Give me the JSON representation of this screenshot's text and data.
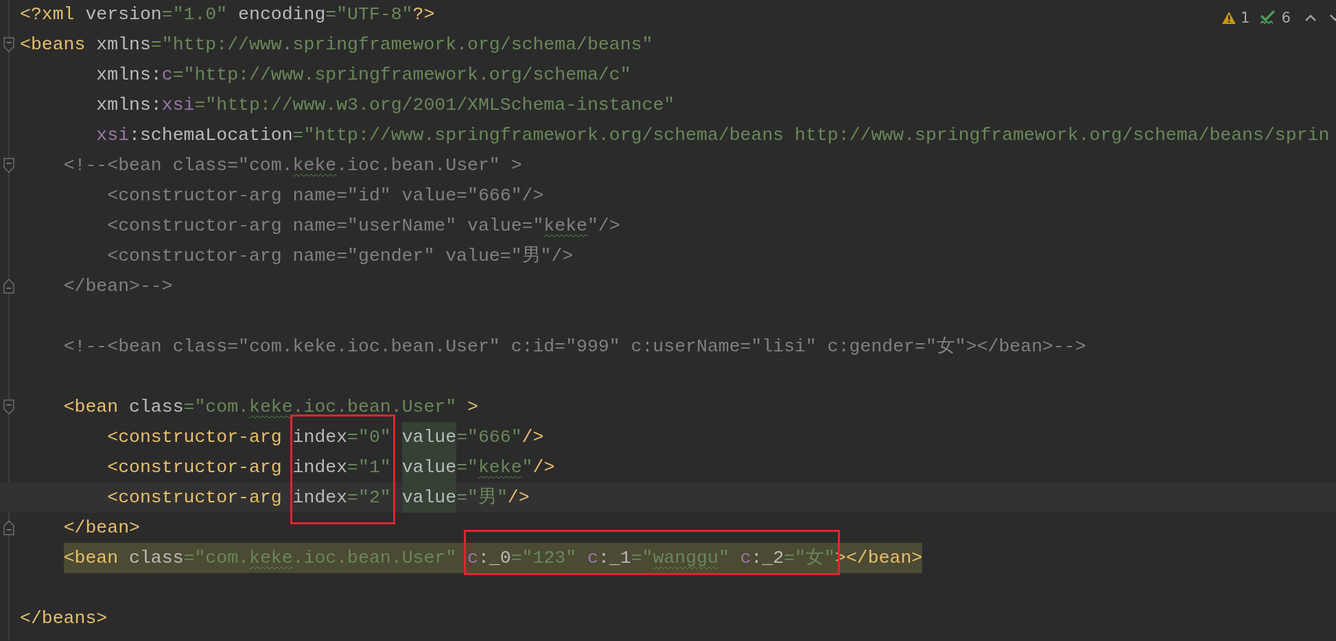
{
  "inspections": {
    "warnings": "1",
    "weak_warnings": "6"
  },
  "lines": [
    {
      "kind": "plain",
      "current": false,
      "highlighted": false,
      "tokens": [
        {
          "t": "<?xml",
          "kind": "tag"
        },
        {
          "t": " version",
          "kind": "attr"
        },
        {
          "t": "=\"1.0\"",
          "kind": "val"
        },
        {
          "t": " encoding",
          "kind": "attr"
        },
        {
          "t": "=\"UTF-8\"",
          "kind": "val"
        },
        {
          "t": "?>",
          "kind": "tag"
        }
      ]
    },
    {
      "kind": "open",
      "current": false,
      "highlighted": false,
      "tokens": [
        {
          "t": "<beans",
          "kind": "tag"
        },
        {
          "t": " xmlns",
          "kind": "attr"
        },
        {
          "t": "=\"http://www.springframework.org/schema/beans\"",
          "kind": "val"
        }
      ]
    },
    {
      "kind": "plain",
      "current": false,
      "highlighted": false,
      "tokens": [
        {
          "t": "       xmlns:",
          "kind": "attr"
        },
        {
          "t": "c",
          "kind": "ns"
        },
        {
          "t": "=\"http://www.springframework.org/schema/c\"",
          "kind": "val"
        }
      ]
    },
    {
      "kind": "plain",
      "current": false,
      "highlighted": false,
      "tokens": [
        {
          "t": "       xmlns:",
          "kind": "attr"
        },
        {
          "t": "xsi",
          "kind": "ns"
        },
        {
          "t": "=\"http://www.w3.org/2001/XMLSchema-instance\"",
          "kind": "val"
        }
      ]
    },
    {
      "kind": "plain",
      "current": false,
      "highlighted": false,
      "tokens": [
        {
          "t": "       xsi",
          "kind": "ns"
        },
        {
          "t": ":schemaLocation",
          "kind": "attr"
        },
        {
          "t": "=\"http://www.springframework.org/schema/beans http://www.springframework.org/schema/beans/sprin",
          "kind": "val"
        }
      ]
    },
    {
      "kind": "open",
      "current": false,
      "highlighted": false,
      "tokens": [
        {
          "t": "    <!--<bean class=\"com.",
          "kind": "cmt"
        },
        {
          "t": "keke",
          "kind": "cmt",
          "typo": true
        },
        {
          "t": ".ioc.bean.User\" >",
          "kind": "cmt"
        }
      ]
    },
    {
      "kind": "plain",
      "current": false,
      "highlighted": false,
      "tokens": [
        {
          "t": "        <constructor-arg name=\"id\" value=\"666\"/>",
          "kind": "cmt"
        }
      ]
    },
    {
      "kind": "plain",
      "current": false,
      "highlighted": false,
      "tokens": [
        {
          "t": "        <constructor-arg name=\"userName\" value=\"",
          "kind": "cmt"
        },
        {
          "t": "keke",
          "kind": "cmt",
          "typo": true
        },
        {
          "t": "\"/>",
          "kind": "cmt"
        }
      ]
    },
    {
      "kind": "plain",
      "current": false,
      "highlighted": false,
      "tokens": [
        {
          "t": "        <constructor-arg name=\"gender\" value=\"男\"/>",
          "kind": "cmt"
        }
      ]
    },
    {
      "kind": "close",
      "current": false,
      "highlighted": false,
      "tokens": [
        {
          "t": "    </bean>-->",
          "kind": "cmt"
        }
      ]
    },
    {
      "kind": "blank"
    },
    {
      "kind": "plain",
      "current": false,
      "highlighted": false,
      "tokens": [
        {
          "t": "    <!--<bean class=\"com.keke.ioc.bean.User\" c:id=\"999\" c:userName=\"lisi\" c:gender=\"女\"></bean>-->",
          "kind": "cmt"
        }
      ]
    },
    {
      "kind": "blank"
    },
    {
      "kind": "open",
      "current": false,
      "highlighted": false,
      "tokens": [
        {
          "t": "    <bean",
          "kind": "tag"
        },
        {
          "t": " class",
          "kind": "attr"
        },
        {
          "t": "=\"com.",
          "kind": "val"
        },
        {
          "t": "keke",
          "kind": "val",
          "typo": true
        },
        {
          "t": ".ioc.bean.User\"",
          "kind": "val"
        },
        {
          "t": " >",
          "kind": "tag"
        }
      ]
    },
    {
      "kind": "plain",
      "current": false,
      "highlighted": false,
      "tokens": [
        {
          "t": "        <constructor-arg",
          "kind": "tag"
        },
        {
          "t": " index",
          "kind": "attr"
        },
        {
          "t": "=\"0\" ",
          "kind": "val"
        },
        {
          "t": "value",
          "kind": "attr",
          "match": true
        },
        {
          "t": "=\"666\"",
          "kind": "val"
        },
        {
          "t": "/>",
          "kind": "tag"
        }
      ]
    },
    {
      "kind": "plain",
      "current": false,
      "highlighted": false,
      "tokens": [
        {
          "t": "        <constructor-arg",
          "kind": "tag"
        },
        {
          "t": " index",
          "kind": "attr"
        },
        {
          "t": "=\"1\" ",
          "kind": "val"
        },
        {
          "t": "value",
          "kind": "attr",
          "match": true
        },
        {
          "t": "=\"",
          "kind": "val"
        },
        {
          "t": "keke",
          "kind": "val",
          "typo": true
        },
        {
          "t": "\"",
          "kind": "val"
        },
        {
          "t": "/>",
          "kind": "tag"
        }
      ]
    },
    {
      "kind": "plain",
      "current": true,
      "highlighted": false,
      "tokens": [
        {
          "t": "        <constructor-arg",
          "kind": "tag"
        },
        {
          "t": " index",
          "kind": "attr"
        },
        {
          "t": "=\"2\" ",
          "kind": "val"
        },
        {
          "t": "value",
          "kind": "attr",
          "match": true
        },
        {
          "t": "=\"男\"",
          "kind": "val"
        },
        {
          "t": "/>",
          "kind": "tag"
        }
      ]
    },
    {
      "kind": "close",
      "current": false,
      "highlighted": false,
      "tokens": [
        {
          "t": "    </bean>",
          "kind": "tag"
        }
      ]
    },
    {
      "kind": "plain",
      "current": false,
      "highlighted": true,
      "tokens": [
        {
          "t": "    <bean",
          "kind": "tag"
        },
        {
          "t": " class",
          "kind": "attr"
        },
        {
          "t": "=\"com.",
          "kind": "val"
        },
        {
          "t": "keke",
          "kind": "val",
          "typo": true
        },
        {
          "t": ".ioc.bean.User\" ",
          "kind": "val"
        },
        {
          "t": "c",
          "kind": "ns"
        },
        {
          "t": ":_0",
          "kind": "attr"
        },
        {
          "t": "=\"123\" ",
          "kind": "val"
        },
        {
          "t": "c",
          "kind": "ns"
        },
        {
          "t": ":_1",
          "kind": "attr"
        },
        {
          "t": "=\"",
          "kind": "val"
        },
        {
          "t": "wanggu",
          "kind": "val",
          "typo": true
        },
        {
          "t": "\" ",
          "kind": "val"
        },
        {
          "t": "c",
          "kind": "ns"
        },
        {
          "t": ":_2",
          "kind": "attr"
        },
        {
          "t": "=\"女\"",
          "kind": "val"
        },
        {
          "t": "></bean>",
          "kind": "tag"
        }
      ]
    },
    {
      "kind": "blank"
    },
    {
      "kind": "plain",
      "current": false,
      "highlighted": false,
      "tokens": [
        {
          "t": "</beans>",
          "kind": "tag"
        }
      ]
    }
  ]
}
